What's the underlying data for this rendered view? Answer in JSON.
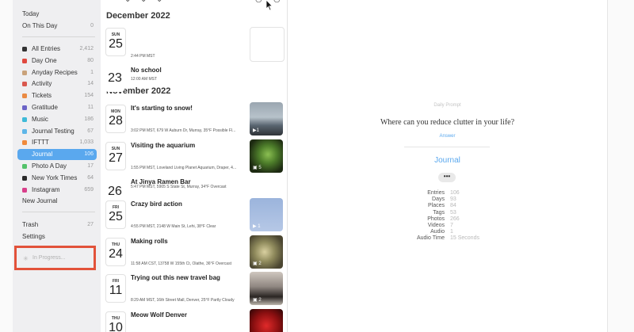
{
  "sidebar": {
    "top_items": [
      {
        "label": "Today",
        "count": ""
      },
      {
        "label": "On This Day",
        "count": "0"
      }
    ],
    "journals": [
      {
        "label": "All Entries",
        "count": "2,412",
        "color": "#333333"
      },
      {
        "label": "Day One",
        "count": "80",
        "color": "#e0493f"
      },
      {
        "label": "Anyday Recipes",
        "count": "1",
        "color": "#c9a27a"
      },
      {
        "label": "Activity",
        "count": "14",
        "color": "#d9584e"
      },
      {
        "label": "Tickets",
        "count": "154",
        "color": "#ea8a43"
      },
      {
        "label": "Gratitude",
        "count": "11",
        "color": "#6b63c6"
      },
      {
        "label": "Music",
        "count": "186",
        "color": "#3fbad8"
      },
      {
        "label": "Journal Testing",
        "count": "67",
        "color": "#5eb6e8"
      },
      {
        "label": "IFTTT",
        "count": "1,033",
        "color": "#f08a3c"
      },
      {
        "label": "Journal",
        "count": "106",
        "color": "#5aa8ee",
        "selected": true
      },
      {
        "label": "Photo A Day",
        "count": "17",
        "color": "#53c26a"
      },
      {
        "label": "New York Times",
        "count": "64",
        "color": "#2a2a2a"
      },
      {
        "label": "Instagram",
        "count": "659",
        "color": "#d93f8b"
      }
    ],
    "new_journal": "New Journal",
    "bottom_items": [
      {
        "label": "Trash",
        "count": "27"
      },
      {
        "label": "Settings",
        "count": ""
      }
    ],
    "progress_label": "In Progress..."
  },
  "timeline": {
    "months": [
      "December 2022",
      "November 2022"
    ],
    "entries": [
      {
        "dow": "SUN",
        "day": "25",
        "title": "",
        "meta": "2:44 PM MST",
        "thumb": "empty"
      },
      {
        "dow": "",
        "day": "23",
        "title": "No school",
        "meta": "12:00 AM MST",
        "thumb": "none"
      },
      {
        "dow": "MON",
        "day": "28",
        "title": "It's starting to snow!",
        "meta": "3:02 PM MST,   679 W Auburn Dr, Murray,  35°F Possible Fl...",
        "thumb": "snow",
        "thumb_badge": "▶1"
      },
      {
        "dow": "SUN",
        "day": "27",
        "title": "Visiting the aquarium",
        "meta": "1:55 PM MST,   Loveland Living Planet Aquarium, Draper,  4...",
        "thumb": "aquarium",
        "thumb_badge": "▣ 5"
      },
      {
        "dow": "",
        "day": "26",
        "title": "At Jinya Ramen Bar",
        "meta": "5:47 PM MST,   5905 S State St, Murray,   34°F Overcast",
        "thumb": "none"
      },
      {
        "dow": "FRI",
        "day": "25",
        "title": "Crazy bird action",
        "meta": "4:55 PM MST,   2148 W Main St, Lehi,   38°F Clear",
        "thumb": "sky",
        "thumb_badge": "▶ 1"
      },
      {
        "dow": "THU",
        "day": "24",
        "title": "Making rolls",
        "meta": "11:58 AM CST,   13758 W 155th Ct, Olathe,   36°F Overcast",
        "thumb": "rolls",
        "thumb_badge": "▣ 2"
      },
      {
        "dow": "FRI",
        "day": "11",
        "title": "Trying out this new travel bag",
        "meta": "8:29 AM MST,   16th Street Mall, Denver,   25°F Partly Cloudy",
        "thumb": "bag",
        "thumb_badge": "▣ 2"
      },
      {
        "dow": "THU",
        "day": "10",
        "title": "Meow Wolf Denver",
        "meta": "",
        "thumb": "red"
      }
    ]
  },
  "detail": {
    "prompt_label": "Daily Prompt",
    "prompt_question": "Where can you reduce clutter in your life?",
    "answer_label": "Answer",
    "journal_name": "Journal",
    "more_label": "•••",
    "stats": [
      {
        "key": "Entries",
        "value": "106"
      },
      {
        "key": "Days",
        "value": "93"
      },
      {
        "key": "Places",
        "value": "84"
      },
      {
        "key": "Tags",
        "value": "53"
      },
      {
        "key": "Photos",
        "value": "266"
      },
      {
        "key": "Videos",
        "value": "7"
      },
      {
        "key": "Audio",
        "value": "1"
      },
      {
        "key": "Audio Time",
        "value": "15 Seconds"
      }
    ]
  }
}
